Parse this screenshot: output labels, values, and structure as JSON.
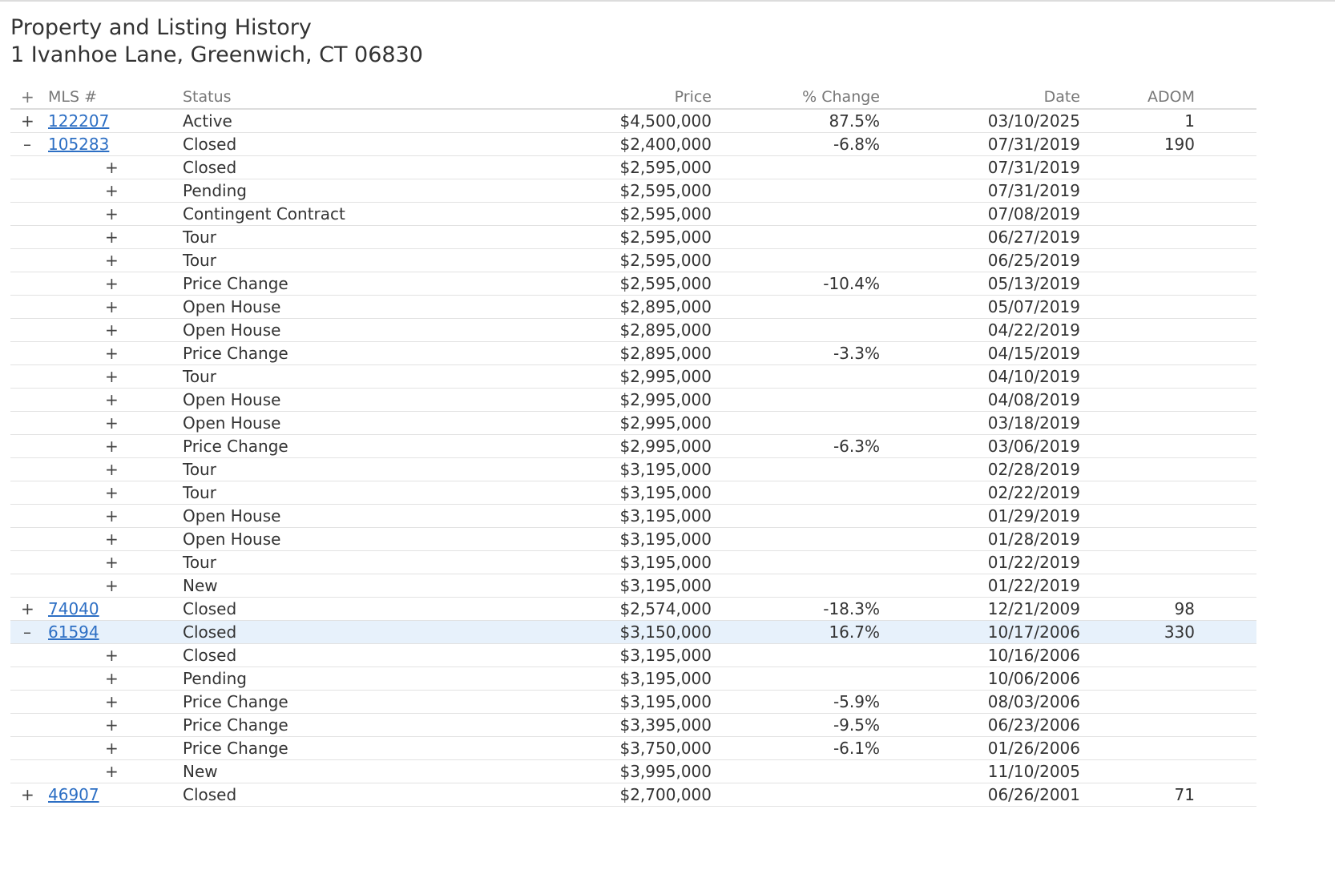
{
  "header": {
    "title": "Property and Listing History",
    "address": "1 Ivanhoe Lane, Greenwich, CT 06830"
  },
  "table": {
    "columns": {
      "expand": "+",
      "mls": "MLS #",
      "status": "Status",
      "price": "Price",
      "change": "% Change",
      "date": "Date",
      "adom": "ADOM"
    },
    "rows": [
      {
        "level": 0,
        "toggle": "+",
        "mls": "122207",
        "status": "Active",
        "price": "$4,500,000",
        "change": "87.5%",
        "date": "03/10/2025",
        "adom": "1"
      },
      {
        "level": 0,
        "toggle": "–",
        "mls": "105283",
        "status": "Closed",
        "price": "$2,400,000",
        "change": "-6.8%",
        "date": "07/31/2019",
        "adom": "190"
      },
      {
        "level": 1,
        "toggle": "+",
        "mls": "",
        "status": "Closed",
        "price": "$2,595,000",
        "change": "",
        "date": "07/31/2019",
        "adom": ""
      },
      {
        "level": 1,
        "toggle": "+",
        "mls": "",
        "status": "Pending",
        "price": "$2,595,000",
        "change": "",
        "date": "07/31/2019",
        "adom": ""
      },
      {
        "level": 1,
        "toggle": "+",
        "mls": "",
        "status": "Contingent Contract",
        "price": "$2,595,000",
        "change": "",
        "date": "07/08/2019",
        "adom": ""
      },
      {
        "level": 1,
        "toggle": "+",
        "mls": "",
        "status": "Tour",
        "price": "$2,595,000",
        "change": "",
        "date": "06/27/2019",
        "adom": ""
      },
      {
        "level": 1,
        "toggle": "+",
        "mls": "",
        "status": "Tour",
        "price": "$2,595,000",
        "change": "",
        "date": "06/25/2019",
        "adom": ""
      },
      {
        "level": 1,
        "toggle": "+",
        "mls": "",
        "status": "Price Change",
        "price": "$2,595,000",
        "change": "-10.4%",
        "date": "05/13/2019",
        "adom": ""
      },
      {
        "level": 1,
        "toggle": "+",
        "mls": "",
        "status": "Open House",
        "price": "$2,895,000",
        "change": "",
        "date": "05/07/2019",
        "adom": ""
      },
      {
        "level": 1,
        "toggle": "+",
        "mls": "",
        "status": "Open House",
        "price": "$2,895,000",
        "change": "",
        "date": "04/22/2019",
        "adom": ""
      },
      {
        "level": 1,
        "toggle": "+",
        "mls": "",
        "status": "Price Change",
        "price": "$2,895,000",
        "change": "-3.3%",
        "date": "04/15/2019",
        "adom": ""
      },
      {
        "level": 1,
        "toggle": "+",
        "mls": "",
        "status": "Tour",
        "price": "$2,995,000",
        "change": "",
        "date": "04/10/2019",
        "adom": ""
      },
      {
        "level": 1,
        "toggle": "+",
        "mls": "",
        "status": "Open House",
        "price": "$2,995,000",
        "change": "",
        "date": "04/08/2019",
        "adom": ""
      },
      {
        "level": 1,
        "toggle": "+",
        "mls": "",
        "status": "Open House",
        "price": "$2,995,000",
        "change": "",
        "date": "03/18/2019",
        "adom": ""
      },
      {
        "level": 1,
        "toggle": "+",
        "mls": "",
        "status": "Price Change",
        "price": "$2,995,000",
        "change": "-6.3%",
        "date": "03/06/2019",
        "adom": ""
      },
      {
        "level": 1,
        "toggle": "+",
        "mls": "",
        "status": "Tour",
        "price": "$3,195,000",
        "change": "",
        "date": "02/28/2019",
        "adom": ""
      },
      {
        "level": 1,
        "toggle": "+",
        "mls": "",
        "status": "Tour",
        "price": "$3,195,000",
        "change": "",
        "date": "02/22/2019",
        "adom": ""
      },
      {
        "level": 1,
        "toggle": "+",
        "mls": "",
        "status": "Open House",
        "price": "$3,195,000",
        "change": "",
        "date": "01/29/2019",
        "adom": ""
      },
      {
        "level": 1,
        "toggle": "+",
        "mls": "",
        "status": "Open House",
        "price": "$3,195,000",
        "change": "",
        "date": "01/28/2019",
        "adom": ""
      },
      {
        "level": 1,
        "toggle": "+",
        "mls": "",
        "status": "Tour",
        "price": "$3,195,000",
        "change": "",
        "date": "01/22/2019",
        "adom": ""
      },
      {
        "level": 1,
        "toggle": "+",
        "mls": "",
        "status": "New",
        "price": "$3,195,000",
        "change": "",
        "date": "01/22/2019",
        "adom": ""
      },
      {
        "level": 0,
        "toggle": "+",
        "mls": "74040",
        "status": "Closed",
        "price": "$2,574,000",
        "change": "-18.3%",
        "date": "12/21/2009",
        "adom": "98"
      },
      {
        "level": 0,
        "toggle": "–",
        "mls": "61594",
        "status": "Closed",
        "price": "$3,150,000",
        "change": "16.7%",
        "date": "10/17/2006",
        "adom": "330",
        "selected": true
      },
      {
        "level": 1,
        "toggle": "+",
        "mls": "",
        "status": "Closed",
        "price": "$3,195,000",
        "change": "",
        "date": "10/16/2006",
        "adom": ""
      },
      {
        "level": 1,
        "toggle": "+",
        "mls": "",
        "status": "Pending",
        "price": "$3,195,000",
        "change": "",
        "date": "10/06/2006",
        "adom": ""
      },
      {
        "level": 1,
        "toggle": "+",
        "mls": "",
        "status": "Price Change",
        "price": "$3,195,000",
        "change": "-5.9%",
        "date": "08/03/2006",
        "adom": ""
      },
      {
        "level": 1,
        "toggle": "+",
        "mls": "",
        "status": "Price Change",
        "price": "$3,395,000",
        "change": "-9.5%",
        "date": "06/23/2006",
        "adom": ""
      },
      {
        "level": 1,
        "toggle": "+",
        "mls": "",
        "status": "Price Change",
        "price": "$3,750,000",
        "change": "-6.1%",
        "date": "01/26/2006",
        "adom": ""
      },
      {
        "level": 1,
        "toggle": "+",
        "mls": "",
        "status": "New",
        "price": "$3,995,000",
        "change": "",
        "date": "11/10/2005",
        "adom": ""
      },
      {
        "level": 0,
        "toggle": "+",
        "mls": "46907",
        "status": "Closed",
        "price": "$2,700,000",
        "change": "",
        "date": "06/26/2001",
        "adom": "71"
      }
    ]
  },
  "colors": {
    "link": "#2d6fc4",
    "selected_row": "#e7f1fb",
    "text": "#333333",
    "header_text": "#777777"
  }
}
